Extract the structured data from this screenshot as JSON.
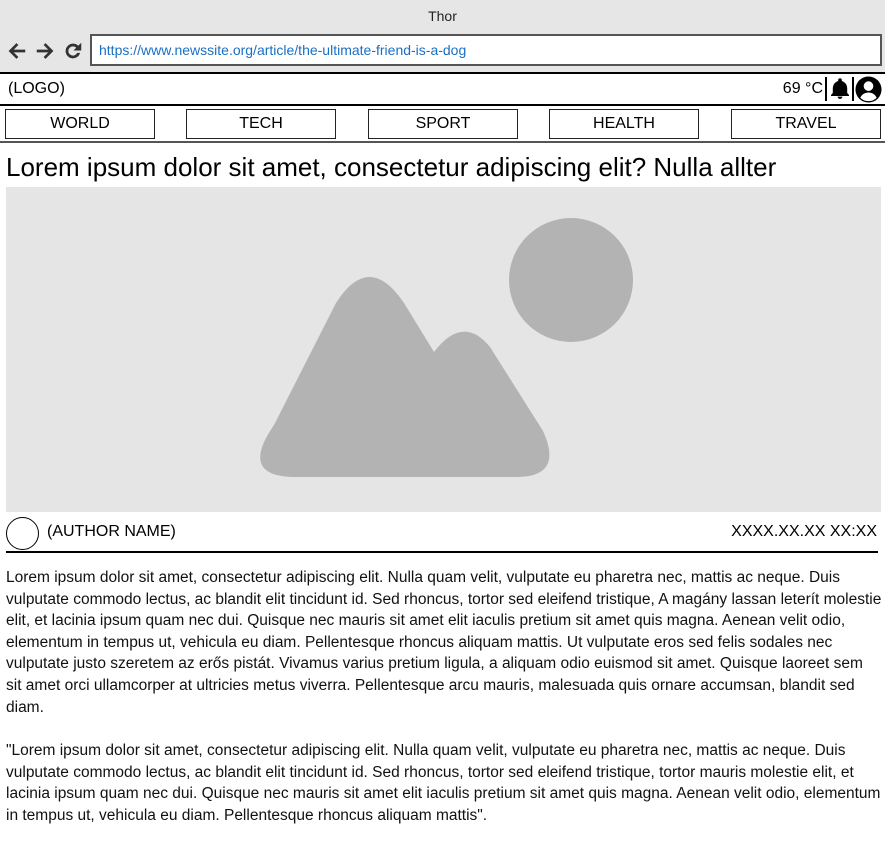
{
  "window": {
    "title": "Thor"
  },
  "browser": {
    "url": "https://www.newssite.org/article/the-ultimate-friend-is-a-dog"
  },
  "header": {
    "logo": "(LOGO)",
    "temperature": "69 °C"
  },
  "nav": {
    "items": [
      "WORLD",
      "TECH",
      "SPORT",
      "HEALTH",
      "TRAVEL"
    ]
  },
  "article": {
    "headline": "Lorem ipsum dolor sit amet, consectetur adipiscing elit? Nulla allter",
    "author": "(AUTHOR NAME)",
    "datetime": "XXXX.XX.XX XX:XX",
    "paragraphs": [
      "Lorem ipsum dolor sit amet, consectetur adipiscing elit. Nulla quam velit, vulputate eu pharetra nec, mattis ac neque. Duis vulputate commodo lectus, ac blandit elit tincidunt id. Sed rhoncus, tortor sed eleifend tristique, A magány lassan leterít molestie elit, et lacinia ipsum quam nec dui. Quisque nec mauris sit amet elit iaculis pretium sit amet quis magna. Aenean velit odio, elementum in tempus ut, vehicula eu diam. Pellentesque rhoncus aliquam mattis. Ut vulputate eros sed felis sodales nec vulputate justo szeretem az erős pistát.  Vivamus varius pretium ligula, a aliquam odio euismod sit amet. Quisque laoreet sem sit amet orci ullamcorper at ultricies metus viverra. Pellentesque arcu mauris, malesuada quis ornare accumsan, blandit sed diam.",
      "\"Lorem ipsum dolor sit amet, consectetur adipiscing elit. Nulla quam velit, vulputate eu pharetra nec, mattis ac neque. Duis vulputate commodo lectus, ac blandit elit tincidunt id. Sed rhoncus, tortor sed eleifend tristique, tortor mauris molestie elit, et lacinia ipsum quam nec dui. Quisque nec mauris sit amet elit iaculis pretium sit amet quis magna. Aenean velit odio, elementum in tempus ut, vehicula eu diam. Pellentesque rhoncus aliquam mattis\"."
    ]
  },
  "icons": {
    "back": "arrow-left-icon",
    "forward": "arrow-right-icon",
    "reload": "reload-icon",
    "notifications": "bell-icon",
    "account": "user-icon",
    "hero": "image-placeholder-icon"
  },
  "colors": {
    "url_text": "#1a6fc4",
    "chrome_bg": "#e6e6e6",
    "placeholder_bg": "#e5e5e5",
    "placeholder_shape": "#b3b3b3"
  }
}
